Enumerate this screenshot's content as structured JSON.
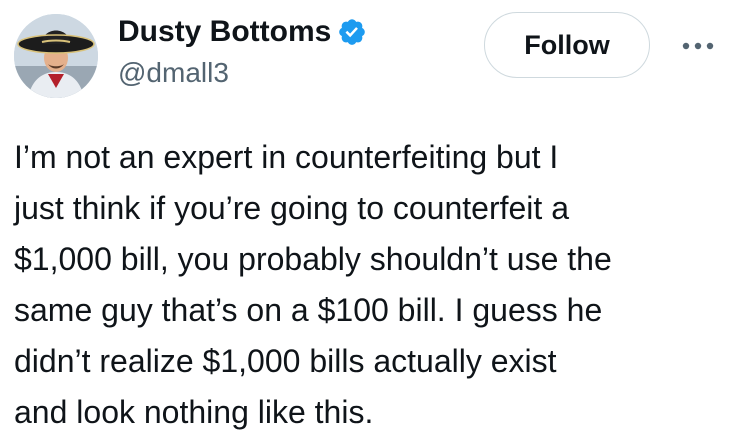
{
  "author": {
    "display_name": "Dusty Bottoms",
    "handle": "@dmall3",
    "verified": true,
    "verified_badge_color": "#1d9bf0",
    "avatar_icon": "profile-photo-sombrero"
  },
  "actions": {
    "follow_label": "Follow",
    "more_icon": "more-horizontal-icon"
  },
  "tweet": {
    "lines": [
      "I’m not an expert in counterfeiting but I",
      "just think if you’re going to counterfeit a",
      "$1,000 bill, you probably shouldn’t use the",
      "same guy that’s on a $100 bill. I guess he",
      "didn’t realize $1,000 bills actually exist",
      "and look nothing like this."
    ]
  },
  "colors": {
    "text_primary": "#0f1419",
    "text_secondary": "#536471",
    "border": "#cfd9de"
  }
}
